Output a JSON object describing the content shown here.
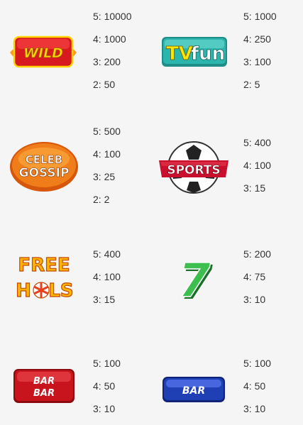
{
  "symbols": [
    {
      "name": "WILD",
      "logo_text": [
        "WILD"
      ],
      "pays": [
        "5: 10000",
        "4: 1000",
        "3: 200",
        "2: 50"
      ]
    },
    {
      "name": "TVfun",
      "logo_text": [
        "TV",
        "fun"
      ],
      "pays": [
        "5: 1000",
        "4: 250",
        "3: 100",
        "2: 5"
      ]
    },
    {
      "name": "CELEB GOSSIP",
      "logo_text": [
        "CELEB",
        "GOSSIP"
      ],
      "pays": [
        "5: 500",
        "4: 100",
        "3: 25",
        "2: 2"
      ]
    },
    {
      "name": "SPORTS",
      "logo_text": [
        "SPORTS"
      ],
      "pays": [
        "5: 400",
        "4: 100",
        "3: 15"
      ]
    },
    {
      "name": "FREE HOLS",
      "logo_text": [
        "FREE",
        "H",
        "LS"
      ],
      "pays": [
        "5: 400",
        "4: 100",
        "3: 15"
      ]
    },
    {
      "name": "7",
      "logo_text": [
        "7"
      ],
      "pays": [
        "5: 200",
        "4: 75",
        "3: 10"
      ]
    },
    {
      "name": "BAR BAR",
      "logo_text": [
        "BAR",
        "BAR"
      ],
      "pays": [
        "5: 100",
        "4: 50",
        "3: 10"
      ]
    },
    {
      "name": "BAR",
      "logo_text": [
        "BAR"
      ],
      "pays": [
        "5: 100",
        "4: 50",
        "3: 10"
      ]
    }
  ],
  "colors": {
    "background": "#f5f5f5",
    "text": "#333333",
    "wild_red": "#d71920",
    "wild_yellow": "#ffd400",
    "tv_teal": "#2bb5ad",
    "gossip_orange": "#ef7d1a",
    "sports_red": "#c8102e",
    "hols_orange": "#f28c00",
    "seven_green": "#2e9e3e",
    "bar_red": "#c8141c",
    "bar_blue": "#1f3fb5"
  }
}
